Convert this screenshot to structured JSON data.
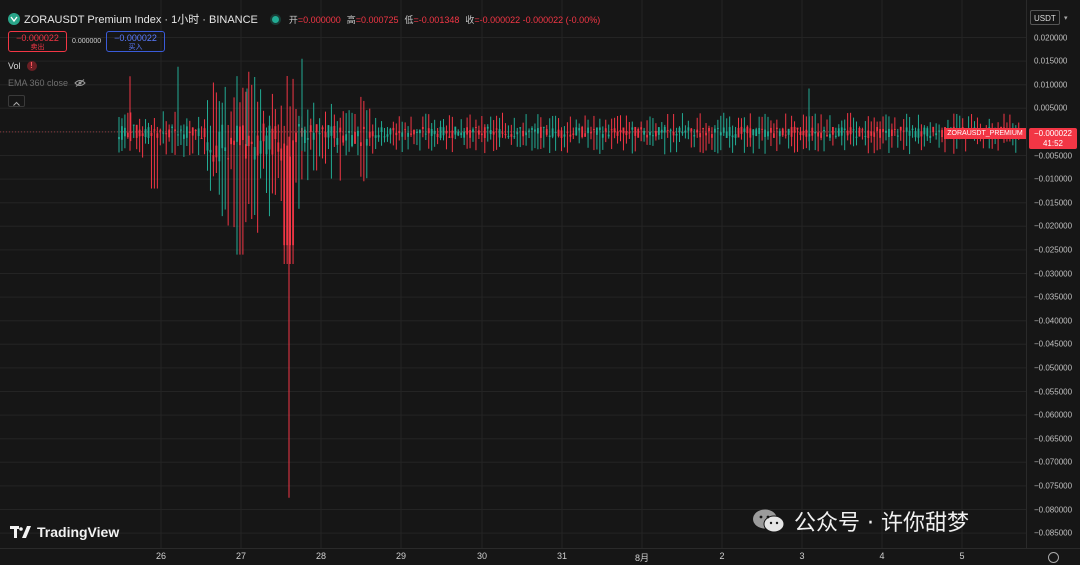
{
  "header": {
    "symbol_title": "ZORAUSDT Premium Index · 1小时 · BINANCE",
    "ohlc": [
      {
        "key": "开",
        "value": "=0.000000"
      },
      {
        "key": "高",
        "value": "=0.000725"
      },
      {
        "key": "低",
        "value": "=-0.001348"
      },
      {
        "key": "收",
        "value": "=-0.000022 -0.000022 (-0.00%)"
      }
    ]
  },
  "trade": {
    "sell_price": "−0.000022",
    "sell_label": "卖出",
    "spread": "0.000000",
    "buy_price": "−0.000022",
    "buy_label": "买入"
  },
  "indicators": {
    "vol_label": "Vol",
    "vol_warning": "!",
    "ema_label": "EMA 360 close"
  },
  "price_axis": {
    "currency": "USDT",
    "ticks": [
      "0.020000",
      "0.015000",
      "0.010000",
      "0.005000",
      "0.000000",
      "−0.005000",
      "−0.010000",
      "−0.015000",
      "−0.020000",
      "−0.025000",
      "−0.030000",
      "−0.035000",
      "−0.040000",
      "−0.045000",
      "−0.050000",
      "−0.055000",
      "−0.060000",
      "−0.065000",
      "−0.070000",
      "−0.075000",
      "−0.080000",
      "−0.085000"
    ],
    "last_price": "−0.000022",
    "countdown": "41:52",
    "series_label": "ZORAUSDT_PREMIUM"
  },
  "time_axis": {
    "ticks": [
      "26",
      "27",
      "28",
      "29",
      "30",
      "31",
      "8月",
      "2",
      "3",
      "4",
      "5"
    ]
  },
  "branding": {
    "tradingview": "TradingView",
    "watermark": "公众号 · 许你甜梦"
  },
  "colors": {
    "up": "#22ab94",
    "down": "#f23645",
    "background": "#161616",
    "grid": "#242424"
  },
  "chart_data": {
    "type": "candlestick",
    "title": "ZORAUSDT Premium Index · 1小时 · BINANCE",
    "y_range": [
      -0.0875,
      0.0225
    ],
    "y_unit": "USDT",
    "x_range": [
      "Jul 25",
      "Aug 5"
    ],
    "notable_points": [
      {
        "label": "minimum low",
        "date": "Jul 27",
        "y": -0.0775
      },
      {
        "label": "maximum high",
        "date": "Jul 27",
        "y": 0.0155
      },
      {
        "label": "close",
        "date": "Aug 5",
        "y": -2.2e-05
      }
    ],
    "open": 0.0,
    "high": 0.000725,
    "low": -0.001348,
    "close": -2.2e-05,
    "grid": true
  }
}
